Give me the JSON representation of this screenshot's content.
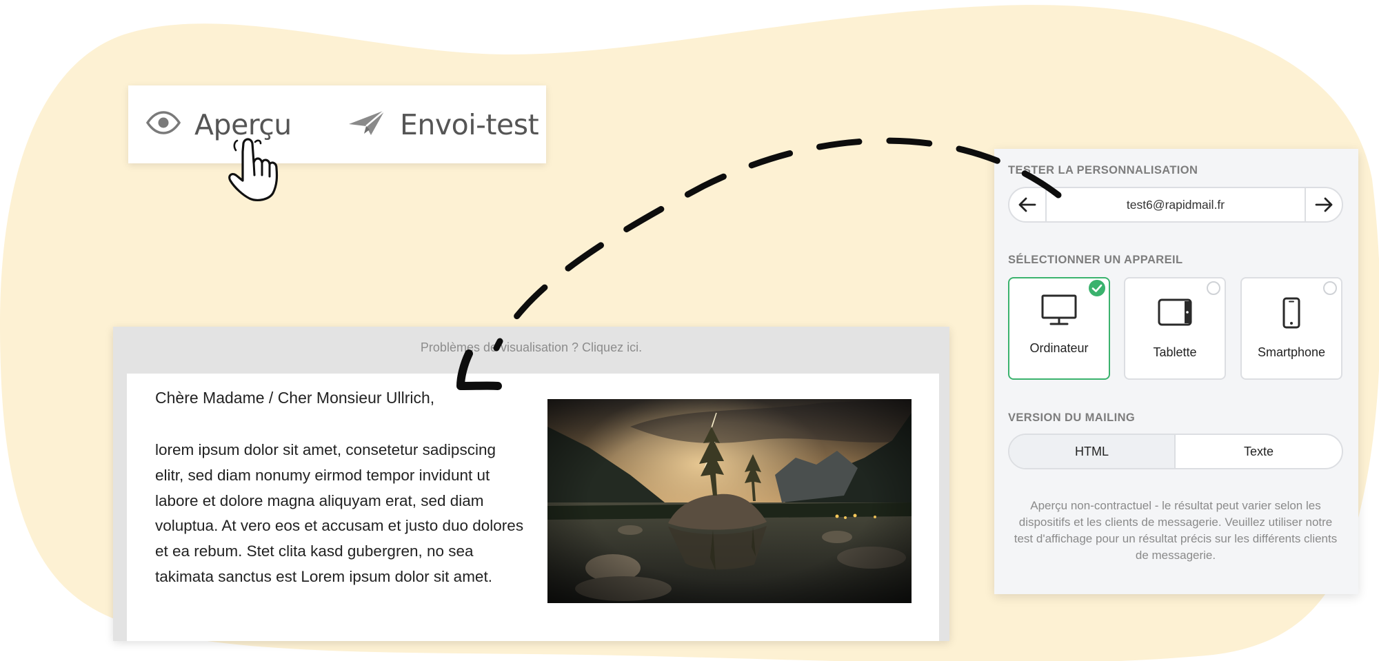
{
  "toolbar": {
    "preview_label": "Aperçu",
    "test_send_label": "Envoi-test",
    "preview_icon": "eye-icon",
    "test_send_icon": "paper-plane-icon",
    "cursor_icon": "hand-pointer-icon"
  },
  "email": {
    "preheader": "Problèmes de visualisation ? Cliquez ici.",
    "greeting": "Chère Madame / Cher Monsieur Ullrich,",
    "body": "lorem ipsum dolor sit amet, consetetur sadipscing elitr, sed diam nonumy eirmod tempor invidunt ut labore et dolore magna aliquyam erat, sed diam voluptua. At vero eos et accusam et justo duo dolores et ea rebum. Stet clita kasd gubergren, no sea takimata sanctus est Lorem ipsum dolor sit amet.",
    "image": "lake-mountain-landscape"
  },
  "panel": {
    "personalization_label": "TESTER LA PERSONNALISATION",
    "test_email": "test6@rapidmail.fr",
    "device_label": "SÉLECTIONNER UN APPAREIL",
    "devices": [
      {
        "label": "Ordinateur",
        "icon": "monitor-icon",
        "selected": true
      },
      {
        "label": "Tablette",
        "icon": "tablet-icon",
        "selected": false
      },
      {
        "label": "Smartphone",
        "icon": "smartphone-icon",
        "selected": false
      }
    ],
    "version_label": "VERSION DU MAILING",
    "versions": [
      "HTML",
      "Texte"
    ],
    "active_version": "HTML",
    "disclaimer": "Aperçu non-contractuel - le résultat peut varier selon les dispositifs et les clients de messagerie. Veuillez utiliser notre test d'affichage pour un résultat précis sur les différents clients de messagerie."
  },
  "colors": {
    "background_blob": "#fdf1d3",
    "selected_green": "#3ab26d",
    "panel_bg": "#f4f5f7",
    "arrow": "#0d0d0d"
  }
}
